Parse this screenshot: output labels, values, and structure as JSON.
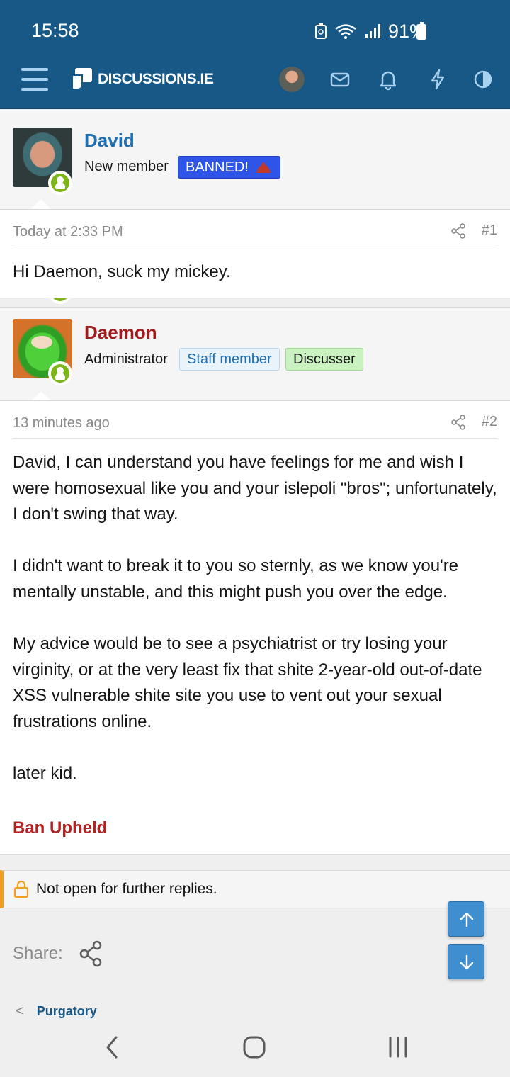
{
  "status_bar": {
    "time": "15:58",
    "battery": "91%"
  },
  "header": {
    "logo_text": "DISCUSSIONS.IE",
    "icons": [
      "menu-icon",
      "avatar",
      "mail-icon",
      "bell-icon",
      "bolt-icon",
      "theme-toggle-icon"
    ]
  },
  "posts": [
    {
      "author": "David",
      "author_color": "#1f6fb3",
      "user_title": "New member",
      "badges": [
        {
          "label": "BANNED!",
          "style": "banned",
          "bg": "#2f55e8",
          "color": "#ffffff"
        }
      ],
      "time": "Today at 2:33 PM",
      "number": "#1",
      "paragraphs": [
        "Hi Daemon, suck my mickey."
      ]
    },
    {
      "author": "Daemon",
      "author_color": "#a11d1d",
      "user_title": "Administrator",
      "badges": [
        {
          "label": "Staff member",
          "bg": "#e8f3fb",
          "color": "#1f6fb3"
        },
        {
          "label": "Discusser",
          "bg": "#c9f2c0",
          "color": "#141414"
        }
      ],
      "time": "13 minutes ago",
      "number": "#2",
      "paragraphs": [
        "David, I can understand you have feelings for me and wish I were homosexual like you and your islepoli \"bros\"; unfortunately, I don't swing that way.",
        "I didn't want to break it to you so sternly, as we know you're mentally unstable, and this might push you over the edge.",
        "My advice would be to see a psychiatrist or try losing your virginity, or at the very least fix that shite 2-year-old out-of-date XSS vulnerable shite site you use to vent out your sexual frustrations online.",
        "later kid."
      ],
      "highlight": "Ban Upheld"
    }
  ],
  "locked_notice": "Not open for further replies.",
  "share_label": "Share:",
  "breadcrumb": "Purgatory"
}
